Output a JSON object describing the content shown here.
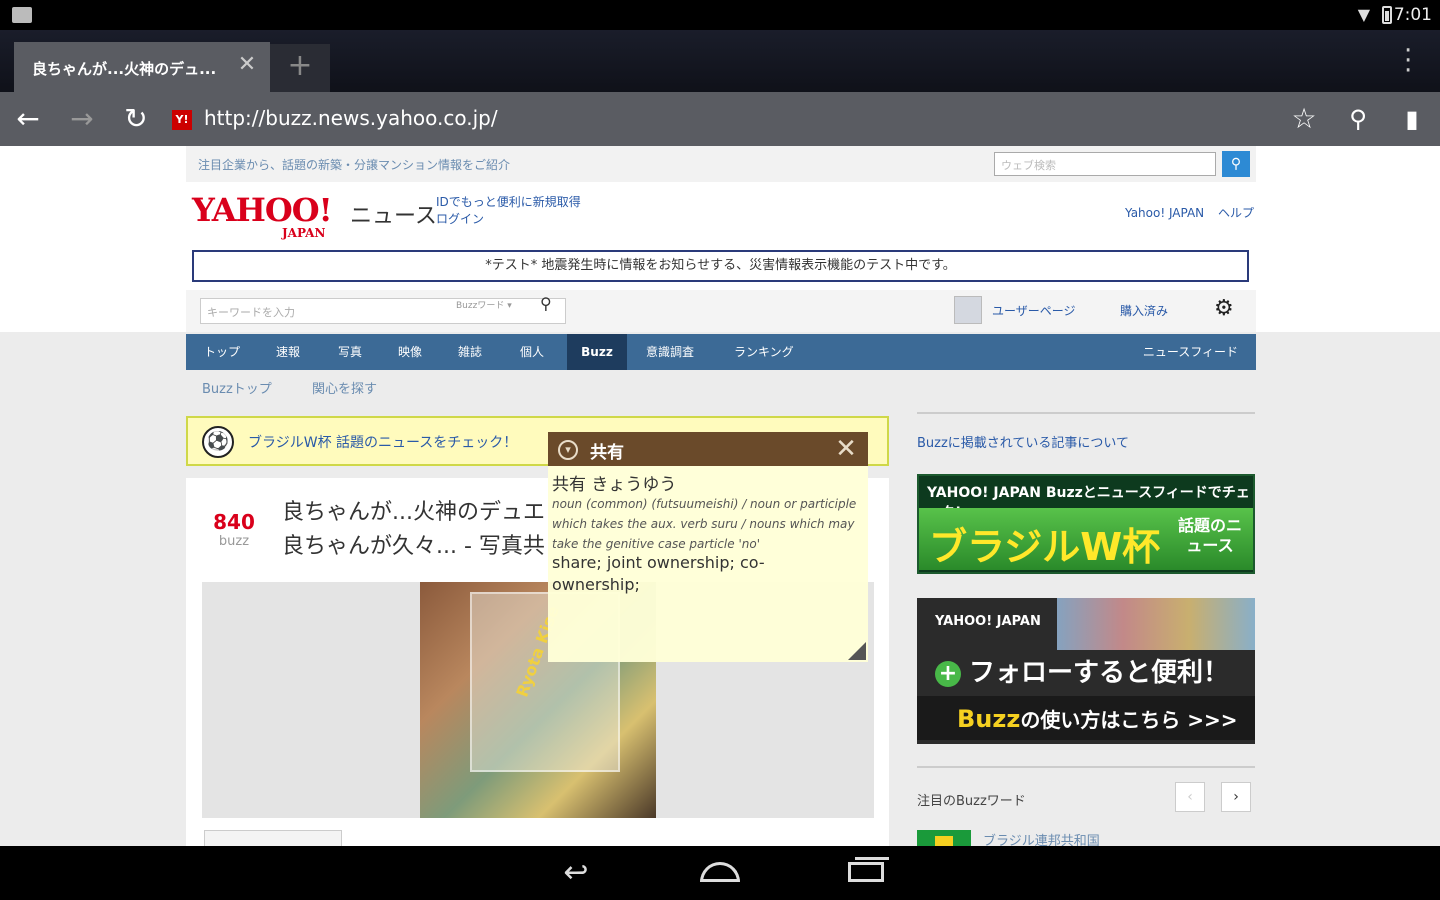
{
  "status_bar": {
    "time": "7:01"
  },
  "browser": {
    "tab_title": "良ちゃんが...火神のデュ...",
    "new_tab": "+",
    "url": "http://buzz.news.yahoo.co.jp/",
    "favicon": "Y!"
  },
  "page": {
    "promo_text": "注目企業から、話題の新築・分譲マンション情報をご紹介",
    "web_search_placeholder": "ウェブ検索",
    "logo_main": "YAHOO!",
    "logo_sub": "JAPAN",
    "section_name": "ニュース",
    "id_promo": "IDでもっと便利に新規取得",
    "login": "ログイン",
    "header_link_yahoo": "Yahoo! JAPAN",
    "header_link_help": "ヘルプ",
    "test_notice": "*テスト* 地震発生時に情報をお知らせする、災害情報表示機能のテスト中です。",
    "keyword_placeholder": "キーワードを入力",
    "keyword_scope": "Buzzワード",
    "user_page": "ユーザーページ",
    "purchased": "購入済み",
    "nav_items": [
      "トップ",
      "速報",
      "写真",
      "映像",
      "雑誌",
      "個人",
      "Buzz",
      "意識調査",
      "ランキング"
    ],
    "nav_right": "ニュースフィード",
    "subnav": [
      "Buzzトップ",
      "関心を探す"
    ],
    "brazil_bar_text": "ブラジルW杯 話題のニュースをチェック！",
    "buzz_count": "840",
    "buzz_unit": "buzz",
    "article_title_1": "良ちゃんが...火神のデュエ",
    "article_title_2": "良ちゃんが久々... - 写真共",
    "cd_text": "Ryota Kise",
    "right_link": "Buzzに掲載されている記事について",
    "banner1_top": "YAHOO! JAPAN Buzzとニュースフィードでチェック!",
    "banner1_main": "ブラジルW杯",
    "banner1_sub": "話題のニュース",
    "banner2_logo": "YAHOO! JAPAN",
    "banner2_follow": "フォローすると便利！",
    "banner2_how_buzz": "Buzz",
    "banner2_how_rest": "の使い方はこちら >>>",
    "buzzword_title": "注目のBuzzワード",
    "pager_prev": "‹",
    "pager_next": "›",
    "brazil_link": "ブラジル連邦共和国"
  },
  "dictionary": {
    "word": "共有",
    "reading": "共有 きょうゆう",
    "pos": "noun (common) (futsuumeishi) / noun or participle which takes the aux. verb suru / nouns which may take the genitive case particle 'no'",
    "definition": "share; joint ownership; co-ownership;"
  }
}
